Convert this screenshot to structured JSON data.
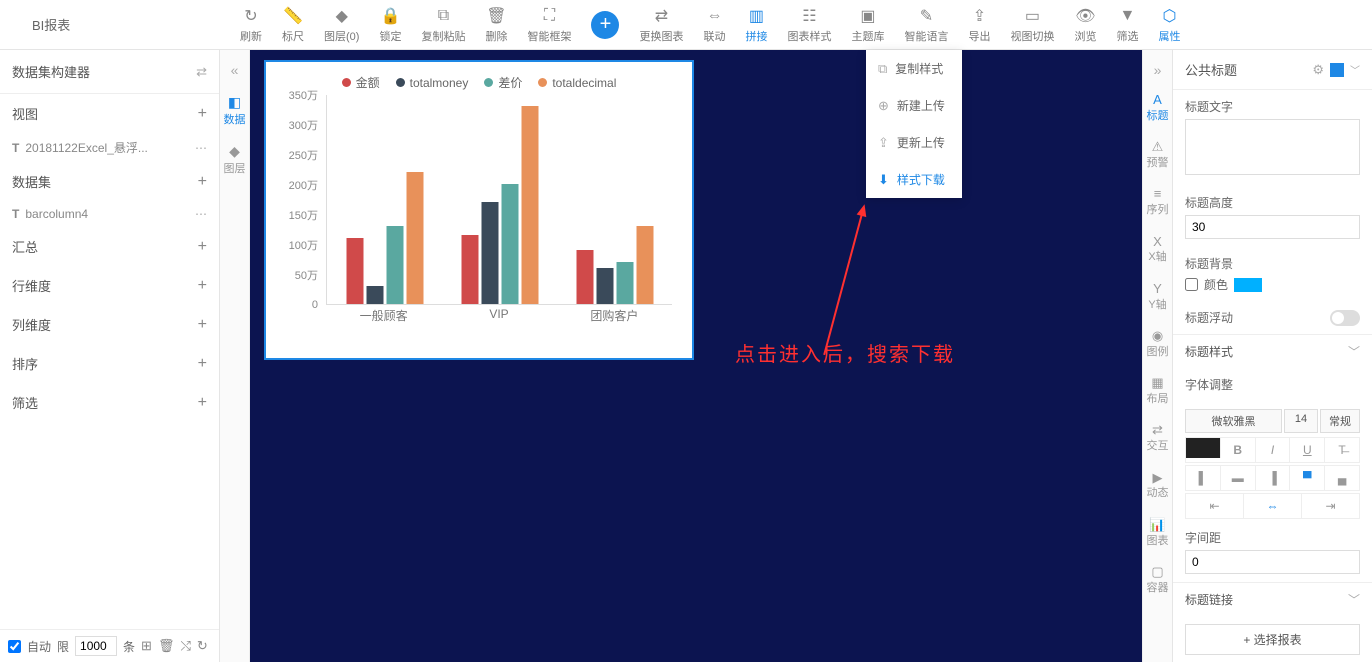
{
  "title": "BI报表",
  "toolbar": [
    {
      "id": "refresh",
      "label": "刷新",
      "icon": "↻"
    },
    {
      "id": "ruler",
      "label": "标尺",
      "icon": "📏"
    },
    {
      "id": "layer",
      "label": "图层(0)",
      "icon": "◆"
    },
    {
      "id": "lock",
      "label": "锁定",
      "icon": "🔒"
    },
    {
      "id": "copypaste",
      "label": "复制粘贴",
      "icon": "⧉"
    },
    {
      "id": "delete",
      "label": "删除",
      "icon": "🗑"
    },
    {
      "id": "smartframe",
      "label": "智能框架",
      "icon": "⛶"
    },
    {
      "id": "add",
      "label": "",
      "icon": "+",
      "big": true
    },
    {
      "id": "changechart",
      "label": "更换图表",
      "icon": "⇄"
    },
    {
      "id": "link",
      "label": "联动",
      "icon": "⇔"
    },
    {
      "id": "join",
      "label": "拼接",
      "icon": "▥",
      "active": true
    },
    {
      "id": "chartstyle",
      "label": "图表样式",
      "icon": "☷"
    },
    {
      "id": "theme",
      "label": "主题库",
      "icon": "▣"
    },
    {
      "id": "voice",
      "label": "智能语言",
      "icon": "✎"
    },
    {
      "id": "export",
      "label": "导出",
      "icon": "⇪"
    },
    {
      "id": "viewswitch",
      "label": "视图切换",
      "icon": "▭"
    },
    {
      "id": "preview",
      "label": "浏览",
      "icon": "👁"
    },
    {
      "id": "filter",
      "label": "筛选",
      "icon": "▼"
    },
    {
      "id": "prop",
      "label": "属性",
      "icon": "⬡",
      "active": true
    }
  ],
  "left": {
    "builder": "数据集构建器",
    "view": "视图",
    "view_item": "20181122Excel_悬浮...",
    "dataset": "数据集",
    "dataset_item": "barcolumn4",
    "summary": "汇总",
    "rowdim": "行维度",
    "coldim": "列维度",
    "sort": "排序",
    "filter": "筛选",
    "auto": "自动",
    "limit": "限",
    "limit_val": "1000",
    "unit": "条"
  },
  "leftstrip": {
    "data": "数据",
    "layer": "图层"
  },
  "rightstrip": [
    "标题",
    "预警",
    "序列",
    "X轴",
    "Y轴",
    "图例",
    "布局",
    "交互",
    "动态",
    "图表",
    "容器"
  ],
  "dropdown": [
    {
      "label": "复制样式",
      "icon": "⧉"
    },
    {
      "label": "新建上传",
      "icon": "⊕"
    },
    {
      "label": "更新上传",
      "icon": "⇪"
    },
    {
      "label": "样式下载",
      "icon": "⬇",
      "hl": true
    }
  ],
  "annotation": "点击进入后，搜索下载",
  "chart_data": {
    "type": "bar",
    "categories": [
      "一般顾客",
      "VIP",
      "团购客户"
    ],
    "series": [
      {
        "name": "金额",
        "color": "#d04a4a",
        "values": [
          110,
          115,
          90
        ]
      },
      {
        "name": "totalmoney",
        "color": "#3a4a5a",
        "values": [
          30,
          170,
          60
        ]
      },
      {
        "name": "差价",
        "color": "#5aa8a0",
        "values": [
          130,
          200,
          70
        ]
      },
      {
        "name": "totaldecimal",
        "color": "#e8915a",
        "values": [
          220,
          330,
          130
        ]
      }
    ],
    "ylabel_suffix": "万",
    "ylim": [
      0,
      350
    ],
    "yticks": [
      0,
      50,
      100,
      150,
      200,
      250,
      300,
      350
    ]
  },
  "right": {
    "header": "公共标题",
    "title_text": "标题文字",
    "title_height": "标题高度",
    "title_height_val": "30",
    "title_bg": "标题背景",
    "color": "颜色",
    "title_float": "标题浮动",
    "title_style": "标题样式",
    "font_adj": "字体调整",
    "font_family": "微软雅黑",
    "font_size": "14",
    "font_weight": "常规",
    "spacing": "字间距",
    "spacing_val": "0",
    "title_link": "标题链接",
    "select_report": "+ 选择报表"
  }
}
